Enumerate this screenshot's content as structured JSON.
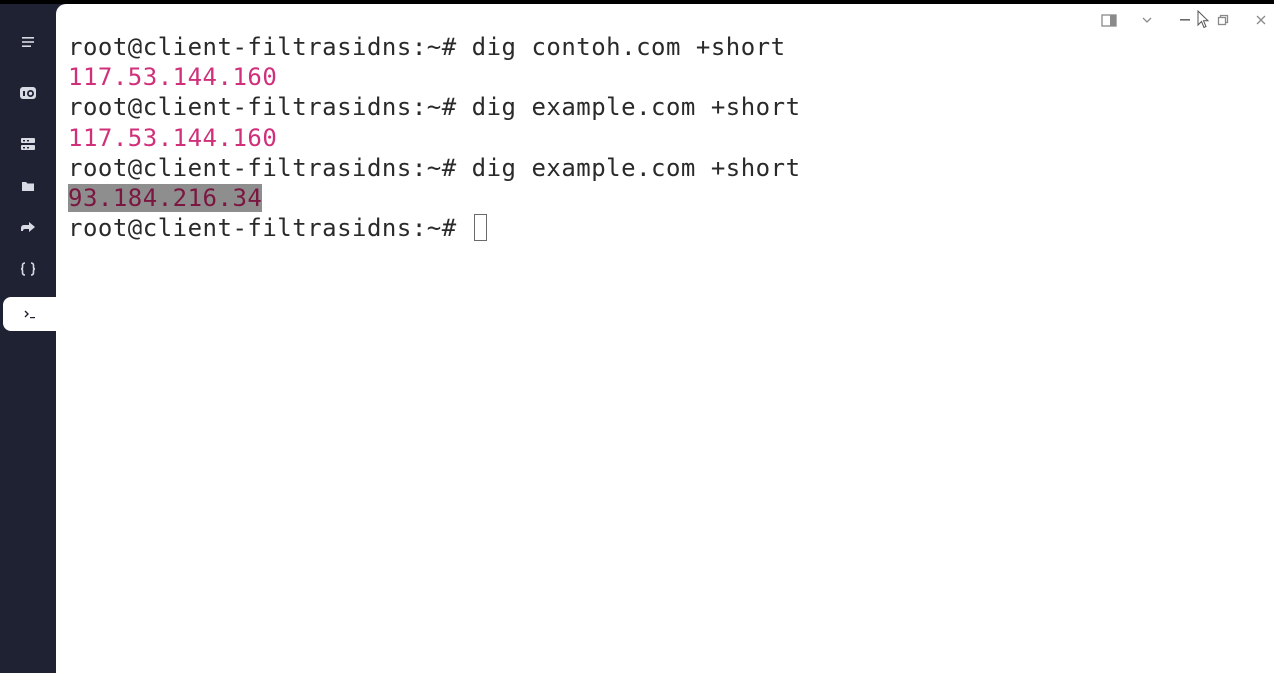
{
  "terminal": {
    "lines": [
      {
        "type": "prompt",
        "prompt": "root@client-filtrasidns:~# ",
        "command": "dig contoh.com +short"
      },
      {
        "type": "output",
        "text": "117.53.144.160"
      },
      {
        "type": "prompt",
        "prompt": "root@client-filtrasidns:~# ",
        "command": "dig example.com +short"
      },
      {
        "type": "output",
        "text": "117.53.144.160"
      },
      {
        "type": "prompt",
        "prompt": "root@client-filtrasidns:~# ",
        "command": "dig example.com +short"
      },
      {
        "type": "output-selected",
        "text": "93.184.216.34"
      },
      {
        "type": "prompt",
        "prompt": "root@client-filtrasidns:~# ",
        "command": ""
      }
    ]
  },
  "sidebar": {
    "items": [
      {
        "name": "menu-icon"
      },
      {
        "name": "keychain-icon"
      },
      {
        "name": "hosts-icon"
      },
      {
        "name": "sftp-folder-icon"
      },
      {
        "name": "port-forwarding-icon"
      },
      {
        "name": "snippets-icon"
      },
      {
        "name": "terminal-icon",
        "active": true
      }
    ]
  },
  "window_controls": [
    "split-view-icon",
    "chevron-down-icon",
    "minimize-icon",
    "restore-icon",
    "close-icon"
  ],
  "colors": {
    "sidebar_bg": "#1e2233",
    "terminal_bg": "#ffffff",
    "text": "#2a2a2a",
    "output": "#d0307a",
    "selection_bg": "#8e8e8e"
  }
}
